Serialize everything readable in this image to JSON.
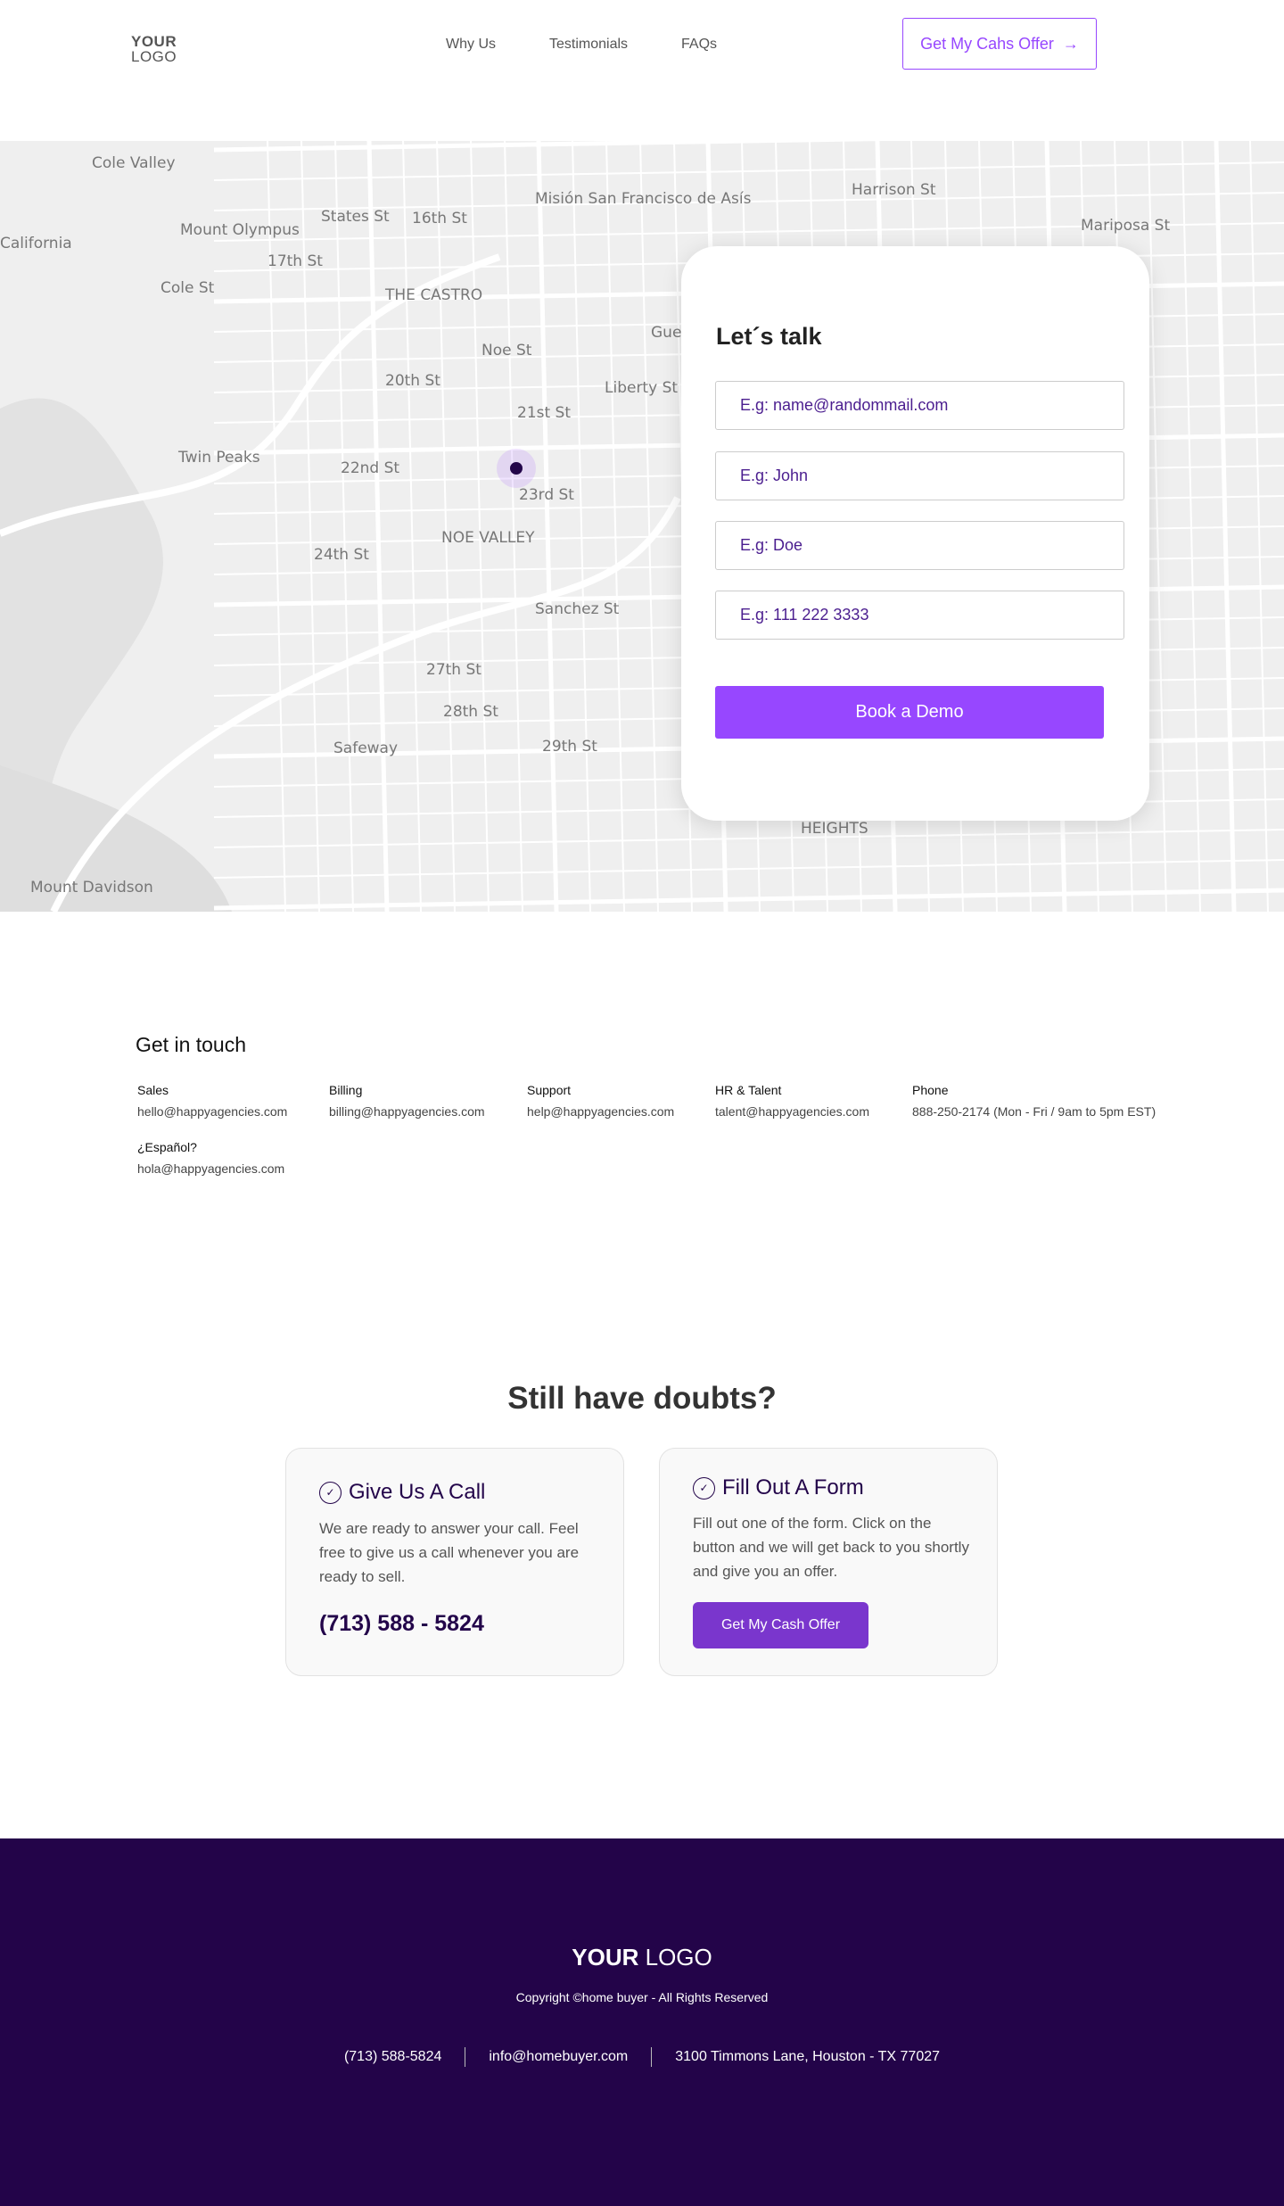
{
  "header": {
    "logo_top": "YOUR",
    "logo_bottom": "LOGO",
    "nav": [
      "Why Us",
      "Testimonials",
      "FAQs"
    ],
    "cta_label": "Get My Cahs Offer",
    "cta_icon": "arrow-right-icon"
  },
  "map": {
    "labels": [
      "Cole Valley",
      "Mount Olympus",
      "California",
      "Twin Peaks",
      "THE CASTRO",
      "NOE VALLEY",
      "Misión San Francisco de Asís",
      "17th St",
      "20th St",
      "21st St",
      "22nd St",
      "23rd St",
      "24th St",
      "27th St",
      "28th St",
      "29th St",
      "Liberty St",
      "Noe St",
      "Guerrero St",
      "Sanchez St",
      "Safeway",
      "Mount Davidson",
      "Mariposa St",
      "HEIGHTS",
      "Harrison St",
      "Cole St",
      "16th St",
      "States St"
    ],
    "marker_color": "#23054a"
  },
  "form": {
    "title": "Let´s talk",
    "fields": [
      {
        "placeholder": "E.g: name@randommail.com"
      },
      {
        "placeholder": "E.g: John"
      },
      {
        "placeholder": "E.g: Doe"
      },
      {
        "placeholder": "E.g: 111 222 3333"
      }
    ],
    "submit_label": "Book a Demo"
  },
  "contact": {
    "title": "Get in touch",
    "items": [
      {
        "label": "Sales",
        "value": "hello@happyagencies.com"
      },
      {
        "label": "Billing",
        "value": "billing@happyagencies.com"
      },
      {
        "label": "Support",
        "value": "help@happyagencies.com"
      },
      {
        "label": "HR & Talent",
        "value": "talent@happyagencies.com"
      },
      {
        "label": "Phone",
        "value": "888-250-2174 (Mon - Fri / 9am to 5pm EST)"
      },
      {
        "label": "¿Español?",
        "value": "hola@happyagencies.com"
      }
    ]
  },
  "doubts": {
    "title": "Still have doubts?",
    "call": {
      "title": "Give Us A Call",
      "text": "We are ready to answer your call. Feel free to give us a call  whenever you are ready to sell.",
      "phone": "(713) 588 - 5824"
    },
    "form": {
      "title": "Fill Out A Form",
      "text": "Fill out one of the form. Click on the button and we will get back to you shortly and give you an offer.",
      "button": "Get My Cash Offer"
    }
  },
  "footer": {
    "logo_bold": "YOUR",
    "logo_light": "LOGO",
    "copyright": "Copyright ©home buyer - All Rights Reserved",
    "phone": "(713) 588-5824",
    "email": "info@homebuyer.com",
    "address": "3100 Timmons Lane, Houston - TX 77027"
  },
  "colors": {
    "accent": "#9747ff",
    "dark": "#23054a",
    "button_dark": "#7a36cd"
  }
}
